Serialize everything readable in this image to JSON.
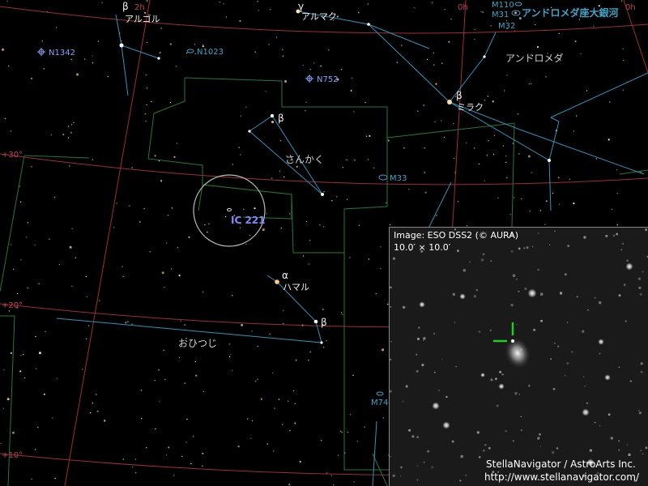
{
  "stars": {
    "algol": {
      "greek": "β",
      "name": "アルゴル"
    },
    "almach": {
      "greek": "γ",
      "name": "アルマク"
    },
    "mirach": {
      "greek": "β",
      "name": "ミラク"
    },
    "beta_tri": {
      "greek": "β"
    },
    "hamal": {
      "greek": "α",
      "name": "ハマル"
    },
    "beta_ari": {
      "greek": "β"
    }
  },
  "constellations": {
    "andromeda": "アンドロメダ",
    "triangulum": "さんかく",
    "aries": "おひつじ"
  },
  "dso": {
    "n1342": "N1342",
    "n1023": "N1023",
    "n752": "N752",
    "m33": "M33",
    "m74": "M74",
    "m110": "M110",
    "m31": "M31",
    "m32": "M32",
    "m31_name": "アンドロメダ座大銀河"
  },
  "target": {
    "name": "IC 221"
  },
  "grid": {
    "ra_0h": "0h",
    "ra_2h": "2h",
    "dec_30_top": "+30°",
    "dec_20": "+20°",
    "dec_10": "+10°"
  },
  "inset": {
    "source": "Image: ESO DSS2 (© AURA)",
    "fov": "10.0′ × 10.0′"
  },
  "credits": {
    "software": "StellaNavigator / AstroArts Inc.",
    "url": "http://www.stellanavigator.com/"
  },
  "colors": {
    "boundary": "#1f8a3a",
    "figure": "#2e9fc4",
    "grid": "#b03040",
    "target": "#7f8cff",
    "marker": "#22cc22"
  }
}
